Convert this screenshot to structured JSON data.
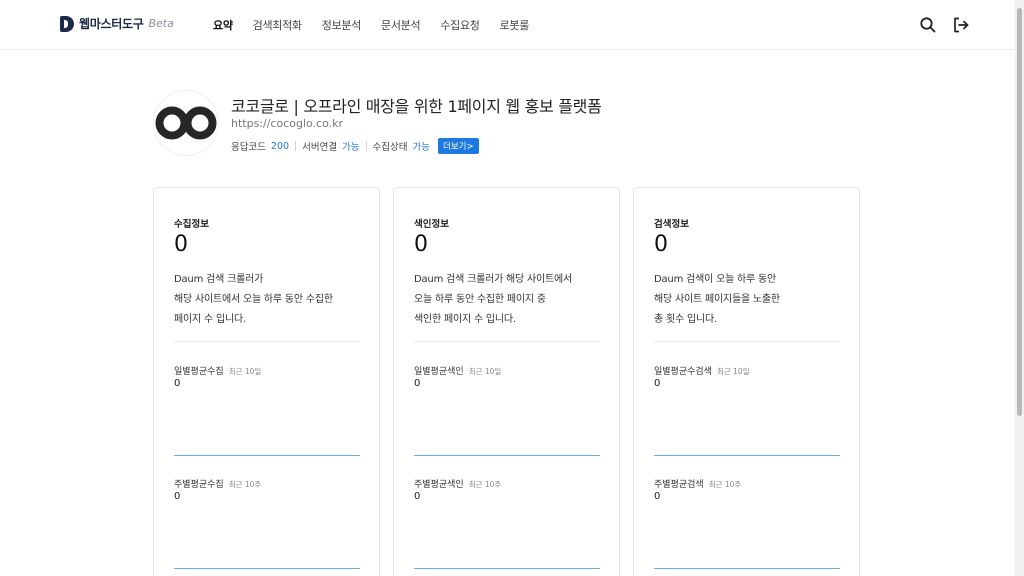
{
  "header": {
    "brand": "웹마스터도구",
    "brand_badge": "Beta",
    "nav": [
      {
        "label": "요약",
        "active": true
      },
      {
        "label": "검색최적화",
        "active": false
      },
      {
        "label": "정보분석",
        "active": false
      },
      {
        "label": "문서분석",
        "active": false
      },
      {
        "label": "수집요청",
        "active": false
      },
      {
        "label": "로봇룰",
        "active": false
      }
    ],
    "icons": [
      "search-icon",
      "logout-icon"
    ]
  },
  "site": {
    "title": "코코글로 | 오프라인 매장을 위한 1페이지 웹 홍보 플랫폼",
    "url": "https://cocoglo.co.kr",
    "status": {
      "response_label": "응답코드",
      "response_value": "200",
      "server_label": "서버연결",
      "server_value": "가능",
      "crawl_label": "수집상태",
      "crawl_value": "가능",
      "more_label": "더보기>"
    },
    "accent_color": "#1f7ae0"
  },
  "cards": [
    {
      "label": "수집정보",
      "count": "0",
      "desc_lines": [
        "Daum 검색 크롤러가",
        "해당 사이트에서 오늘 하루 동안 수집한",
        "페이지 수 입니다."
      ],
      "daily": {
        "label": "일별평균수집",
        "sub": "최근 10일",
        "value": "0"
      },
      "weekly": {
        "label": "주별평균수집",
        "sub": "최근 10주",
        "value": "0"
      }
    },
    {
      "label": "색인정보",
      "count": "0",
      "desc_lines": [
        "Daum 검색 크롤러가 해당 사이트에서",
        "오늘 하루 동안 수집한 페이지 중",
        "색인한 페이지 수 입니다."
      ],
      "daily": {
        "label": "일별평균색인",
        "sub": "최근 10일",
        "value": "0"
      },
      "weekly": {
        "label": "주별평균색인",
        "sub": "최근 10주",
        "value": "0"
      }
    },
    {
      "label": "검색정보",
      "count": "0",
      "desc_lines": [
        "Daum 검색이 오늘 하루 동안",
        "해당 사이트 페이지들을 노출한",
        "총 횟수 입니다."
      ],
      "daily": {
        "label": "일별평균수검색",
        "sub": "최근 10일",
        "value": "0"
      },
      "weekly": {
        "label": "주별평균검색",
        "sub": "최근 10주",
        "value": "0"
      }
    }
  ]
}
